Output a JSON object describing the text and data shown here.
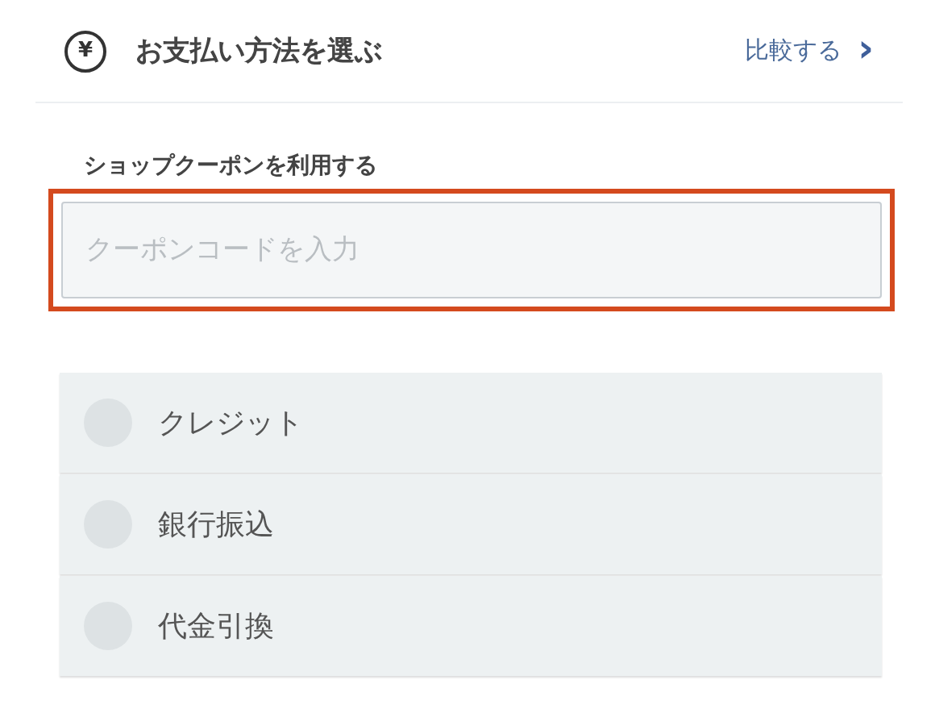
{
  "header": {
    "icon": "¥",
    "title": "お支払い方法を選ぶ",
    "link": "比較する",
    "chevron": "›"
  },
  "coupon": {
    "label": "ショップクーポンを利用する",
    "placeholder": "クーポンコードを入力",
    "highlighted": true
  },
  "payment_options": [
    {
      "label": "クレジット",
      "selected": false
    },
    {
      "label": "銀行振込",
      "selected": false
    },
    {
      "label": "代金引換",
      "selected": false
    }
  ]
}
